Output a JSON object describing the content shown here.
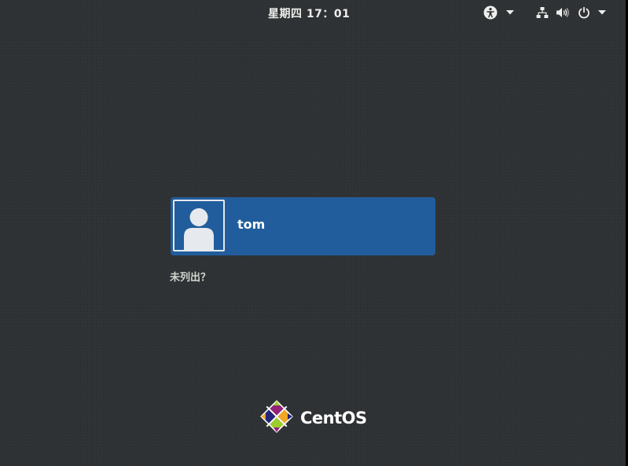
{
  "topbar": {
    "clock": "星期四 17：01",
    "icons": {
      "accessibility": "accessibility-icon",
      "network": "network-wired-icon",
      "volume": "volume-icon",
      "power": "power-icon",
      "menu_arrow": "chevron-down-icon"
    }
  },
  "login": {
    "users": [
      {
        "name": "tom",
        "avatar": "default-user-avatar-icon"
      }
    ],
    "not_listed_label": "未列出？",
    "selected_color": "#215d9c"
  },
  "branding": {
    "logo_text": "CentOS",
    "logo_icon": "centos-logo-icon"
  },
  "colors": {
    "background": "#2e3133",
    "accent": "#215d9c",
    "text": "#eeeeec"
  }
}
